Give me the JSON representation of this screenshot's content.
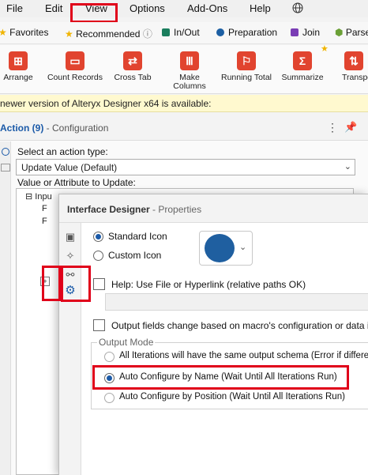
{
  "menu": {
    "items": [
      "File",
      "Edit",
      "View",
      "Options",
      "Add-Ons",
      "Help"
    ],
    "globe_icon": "globe-icon"
  },
  "categories": [
    {
      "label": "Favorites",
      "icon": "star-icon",
      "color": "#f0b400"
    },
    {
      "label": "Recommended",
      "icon": "star-icon",
      "color": "#f0b400",
      "info": "ⓘ"
    },
    {
      "label": "In/Out",
      "icon": "folder-icon",
      "color": "#1a7e5d"
    },
    {
      "label": "Preparation",
      "icon": "circle-icon",
      "color": "#1c5fa3"
    },
    {
      "label": "Join",
      "icon": "square-icon",
      "color": "#7a3db5"
    },
    {
      "label": "Parse",
      "icon": "hexagon-icon",
      "color": "#6ba036"
    }
  ],
  "tools": [
    {
      "label": "Arrange",
      "icon": "arrange-icon"
    },
    {
      "label": "Count Records",
      "icon": "count-records-icon"
    },
    {
      "label": "Cross Tab",
      "icon": "cross-tab-icon"
    },
    {
      "label": "Make Columns",
      "label1": "Make",
      "label2": "Columns",
      "icon": "make-columns-icon"
    },
    {
      "label": "Running Total",
      "icon": "running-total-icon"
    },
    {
      "label": "Summarize",
      "icon": "summarize-icon"
    },
    {
      "label": "Transpo",
      "icon": "transpose-icon"
    }
  ],
  "notice": "newer version of Alteryx Designer x64 is available:",
  "config": {
    "title_prefix": "Action (9)",
    "title_suffix": " - Configuration",
    "action_label": "Select an action type:",
    "action_value": "Update Value (Default)",
    "attr_label": "Value or Attribute to Update:",
    "tree_item": "Inpu",
    "tree_sub1": "F",
    "tree_sub2": "F"
  },
  "designer": {
    "title_prefix": "Interface Designer",
    "title_suffix": " - Properties",
    "icon_standard": "Standard Icon",
    "icon_custom": "Custom Icon",
    "icon_color": "#1f5fa0",
    "help_label": "Help: Use File or Hyperlink (relative paths OK)",
    "output_fields_label": "Output fields change based on macro's configuration or data i",
    "output_mode_label": "Output Mode",
    "mode_all": "All Iterations will have the same output schema (Error if differen",
    "mode_name": "Auto Configure by Name (Wait Until All Iterations Run)",
    "mode_position": "Auto Configure by Position (Wait Until All Iterations Run)"
  }
}
